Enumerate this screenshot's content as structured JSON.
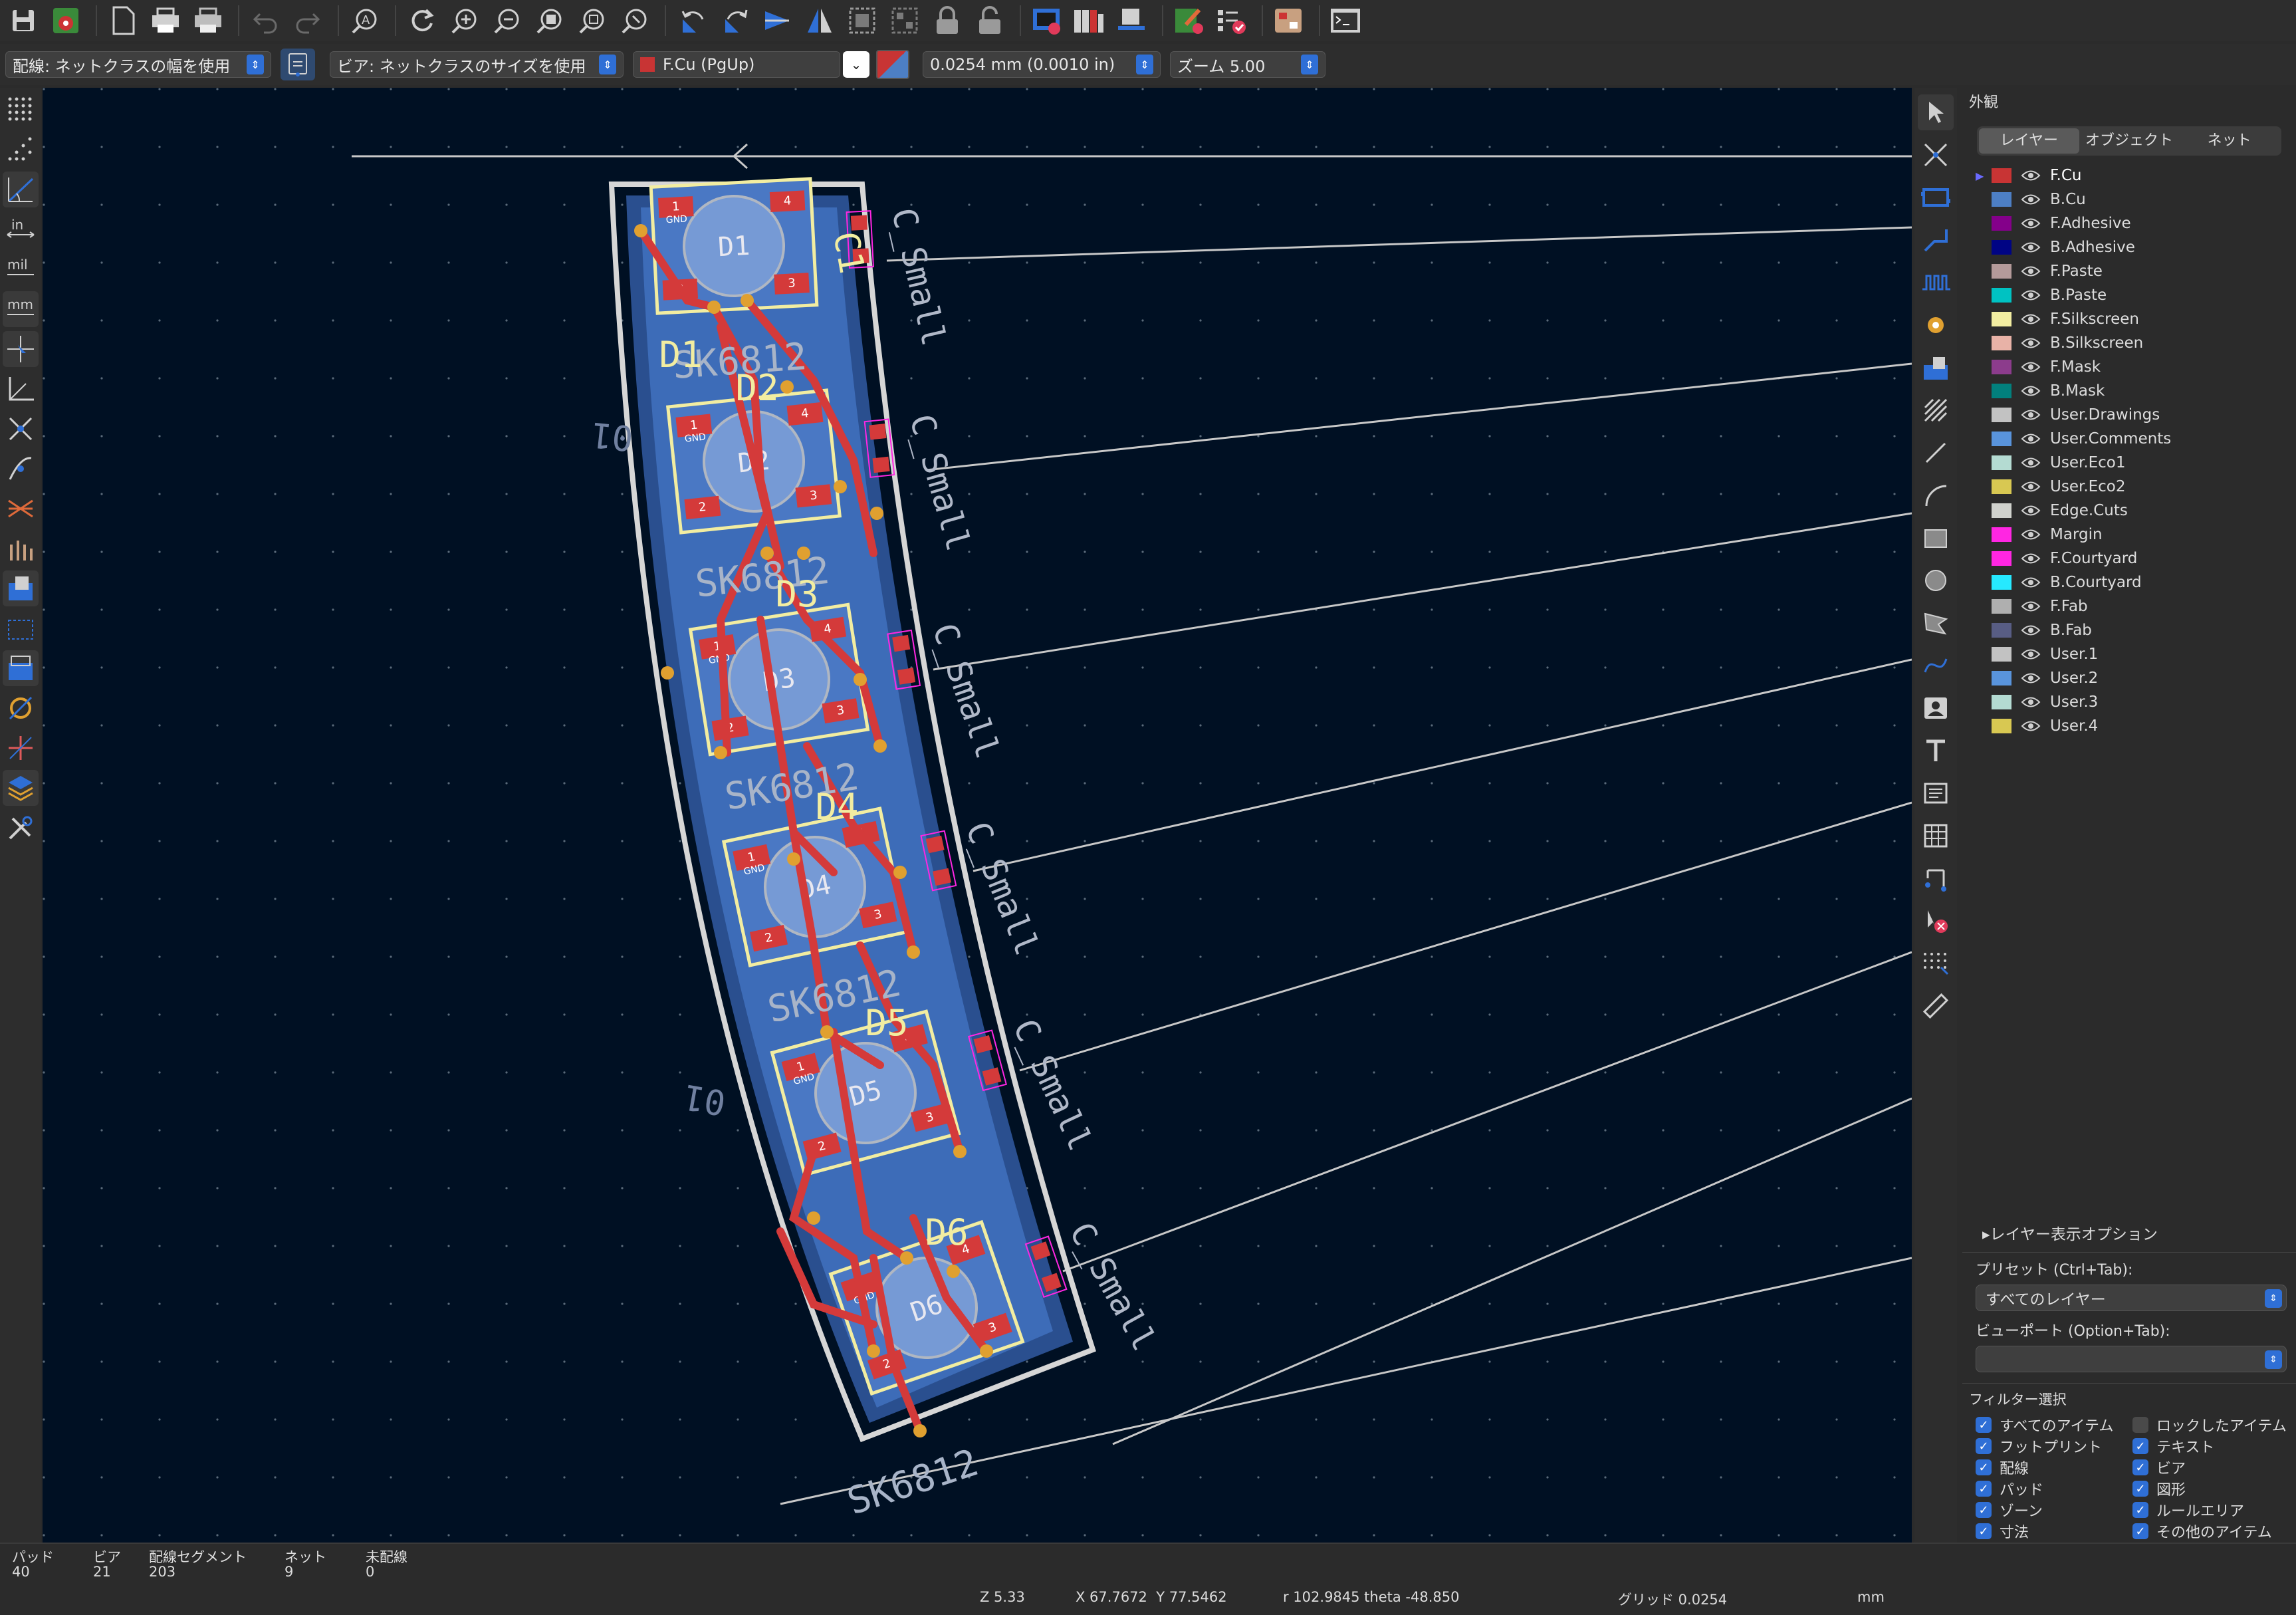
{
  "toolbar": {
    "icons": [
      "save-icon",
      "board-setup-icon",
      "page-icon",
      "print-icon",
      "plot-icon",
      "undo-icon",
      "redo-icon",
      "find-icon",
      "refresh-icon",
      "zoom-in-icon",
      "zoom-out-icon",
      "zoom-fit-icon",
      "zoom-objects-icon",
      "zoom-selection-icon",
      "rotate-ccw-icon",
      "rotate-cw-icon",
      "flip-icon",
      "mirror-icon",
      "group-icon",
      "ungroup-icon",
      "lock-icon",
      "unlock-icon",
      "netlist-icon",
      "footprint-library-icon",
      "footprint-editor-icon",
      "drc-icon",
      "checklist-icon",
      "plugin-icon",
      "scripting-console-icon"
    ]
  },
  "toolbar2": {
    "track_width": "配線: ネットクラスの幅を使用",
    "via_size": "ビア: ネットクラスのサイズを使用",
    "layer": "F.Cu (PgUp)",
    "grid": "0.0254 mm (0.0010 in)",
    "zoom": "ズーム 5.00"
  },
  "canvas": {
    "ref_labels": [
      "D1",
      "D2",
      "D3",
      "D4",
      "D5",
      "D6",
      "C1"
    ],
    "value_labels": [
      "SK6812",
      "SK6812",
      "SK6812",
      "SK6812",
      "SK6812"
    ],
    "cap_labels": [
      "C_Small",
      "C_Small",
      "C_Small",
      "C_Small",
      "C_Small",
      "C_Small"
    ],
    "mirror_labels": [
      "01",
      "01"
    ],
    "gnd": "GND",
    "pad_numbers": [
      "1",
      "2",
      "3",
      "4"
    ]
  },
  "panel": {
    "title": "外観",
    "tabs": [
      "レイヤー",
      "オブジェクト",
      "ネット"
    ],
    "layers": [
      {
        "name": "F.Cu",
        "color": "#c83434"
      },
      {
        "name": "B.Cu",
        "color": "#4d7fc4"
      },
      {
        "name": "F.Adhesive",
        "color": "#84008a"
      },
      {
        "name": "B.Adhesive",
        "color": "#000484"
      },
      {
        "name": "F.Paste",
        "color": "#b49a9a"
      },
      {
        "name": "B.Paste",
        "color": "#00c2c2"
      },
      {
        "name": "F.Silkscreen",
        "color": "#f2eda1"
      },
      {
        "name": "B.Silkscreen",
        "color": "#e8b2a7"
      },
      {
        "name": "F.Mask",
        "color": "#8c3c8c"
      },
      {
        "name": "B.Mask",
        "color": "#02807d"
      },
      {
        "name": "User.Drawings",
        "color": "#c2c2c2"
      },
      {
        "name": "User.Comments",
        "color": "#5994dc"
      },
      {
        "name": "User.Eco1",
        "color": "#b4dbd2"
      },
      {
        "name": "User.Eco2",
        "color": "#d8c852"
      },
      {
        "name": "Edge.Cuts",
        "color": "#d0d2cd"
      },
      {
        "name": "Margin",
        "color": "#ff26e2"
      },
      {
        "name": "F.Courtyard",
        "color": "#ff26e2"
      },
      {
        "name": "B.Courtyard",
        "color": "#26e9ff"
      },
      {
        "name": "F.Fab",
        "color": "#afafaf"
      },
      {
        "name": "B.Fab",
        "color": "#585d84"
      },
      {
        "name": "User.1",
        "color": "#c2c2c2"
      },
      {
        "name": "User.2",
        "color": "#5994dc"
      },
      {
        "name": "User.3",
        "color": "#b4dbd2"
      },
      {
        "name": "User.4",
        "color": "#d8c852"
      }
    ],
    "layer_display_options": "レイヤー表示オプション",
    "preset_label": "プリセット (Ctrl+Tab):",
    "preset_value": "すべてのレイヤー",
    "viewport_label": "ビューポート (Option+Tab):",
    "viewport_value": "",
    "filter_title": "フィルター選択",
    "filters": [
      {
        "label": "すべてのアイテム",
        "checked": true
      },
      {
        "label": "ロックしたアイテム",
        "checked": false
      },
      {
        "label": "フットプリント",
        "checked": true
      },
      {
        "label": "テキスト",
        "checked": true
      },
      {
        "label": "配線",
        "checked": true
      },
      {
        "label": "ビア",
        "checked": true
      },
      {
        "label": "パッド",
        "checked": true
      },
      {
        "label": "図形",
        "checked": true
      },
      {
        "label": "ゾーン",
        "checked": true
      },
      {
        "label": "ルールエリア",
        "checked": true
      },
      {
        "label": "寸法",
        "checked": true
      },
      {
        "label": "その他のアイテム",
        "checked": true
      }
    ]
  },
  "status": {
    "pads_label": "パッド",
    "pads": "40",
    "vias_label": "ビア",
    "vias": "21",
    "segments_label": "配線セグメント",
    "segments": "203",
    "nets_label": "ネット",
    "nets": "9",
    "unrouted_label": "未配線",
    "unrouted": "0",
    "z": "Z 5.33",
    "xy": "X 67.7672  Y 77.5462",
    "polar": "r 102.9845  theta -48.850",
    "grid": "グリッド 0.0254",
    "units": "mm"
  }
}
